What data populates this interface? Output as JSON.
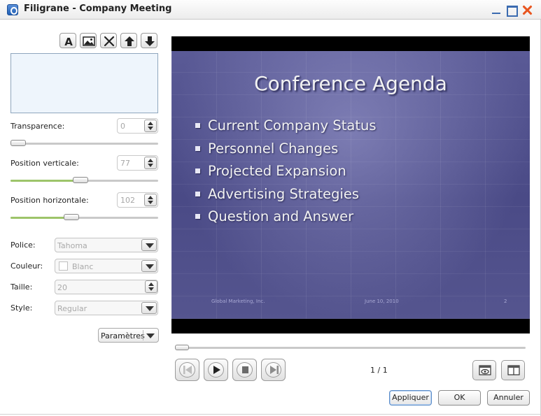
{
  "window": {
    "title": "Filigrane - Company Meeting"
  },
  "toolbar": {
    "buttons": [
      "text-icon",
      "image-icon",
      "delete-icon",
      "move-up-icon",
      "move-down-icon"
    ]
  },
  "controls": {
    "transparence": {
      "label": "Transparence:",
      "value": "0",
      "slider": 0.0
    },
    "position_verticale": {
      "label": "Position verticale:",
      "value": "77",
      "slider": 0.42
    },
    "position_horizontale": {
      "label": "Position horizontale:",
      "value": "102",
      "slider": 0.36
    }
  },
  "font": {
    "police_label": "Police:",
    "police_value": "Tahoma",
    "couleur_label": "Couleur:",
    "couleur_value": "Blanc",
    "taille_label": "Taille:",
    "taille_value": "20",
    "style_label": "Style:",
    "style_value": "Regular"
  },
  "params_button": "Paramètres",
  "slide": {
    "title": "Conference Agenda",
    "bullets": [
      "Current Company Status",
      "Personnel Changes",
      "Projected Expansion",
      "Advertising Strategies",
      "Question and Answer"
    ],
    "footer_left": "Global Marketing, Inc.",
    "footer_center": "June 10, 2010",
    "footer_right": "2"
  },
  "playback": {
    "page_indicator": "1 / 1",
    "progress": 0.0
  },
  "dialog": {
    "apply": "Appliquer",
    "ok": "OK",
    "cancel": "Annuler"
  },
  "colors": {
    "slide_bg": "#4d4d8a",
    "accent": "#9dc46a"
  }
}
